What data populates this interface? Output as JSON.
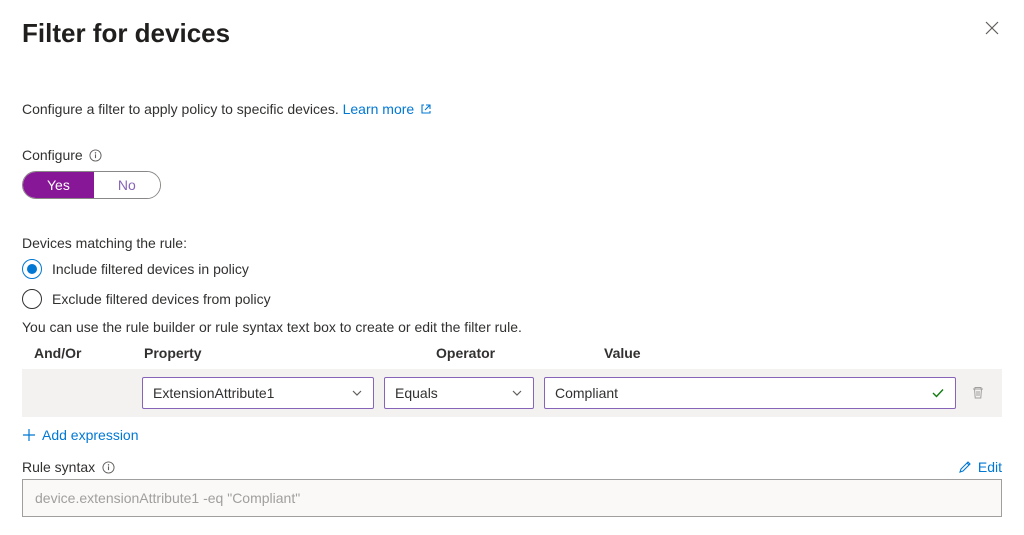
{
  "header": {
    "title": "Filter for devices"
  },
  "intro": {
    "text": "Configure a filter to apply policy to specific devices. ",
    "learn_more": "Learn more"
  },
  "configure": {
    "label": "Configure",
    "yes": "Yes",
    "no": "No",
    "selected": "Yes"
  },
  "matching": {
    "heading": "Devices matching the rule:",
    "include_label": "Include filtered devices in policy",
    "exclude_label": "Exclude filtered devices from policy",
    "hint": "You can use the rule builder or rule syntax text box to create or edit the filter rule."
  },
  "columns": {
    "andor": "And/Or",
    "property": "Property",
    "operator": "Operator",
    "value": "Value"
  },
  "expression": {
    "property": "ExtensionAttribute1",
    "operator": "Equals",
    "value": "Compliant"
  },
  "add_expression": "Add expression",
  "rule_syntax": {
    "label": "Rule syntax",
    "edit": "Edit",
    "text": "device.extensionAttribute1 -eq \"Compliant\""
  }
}
